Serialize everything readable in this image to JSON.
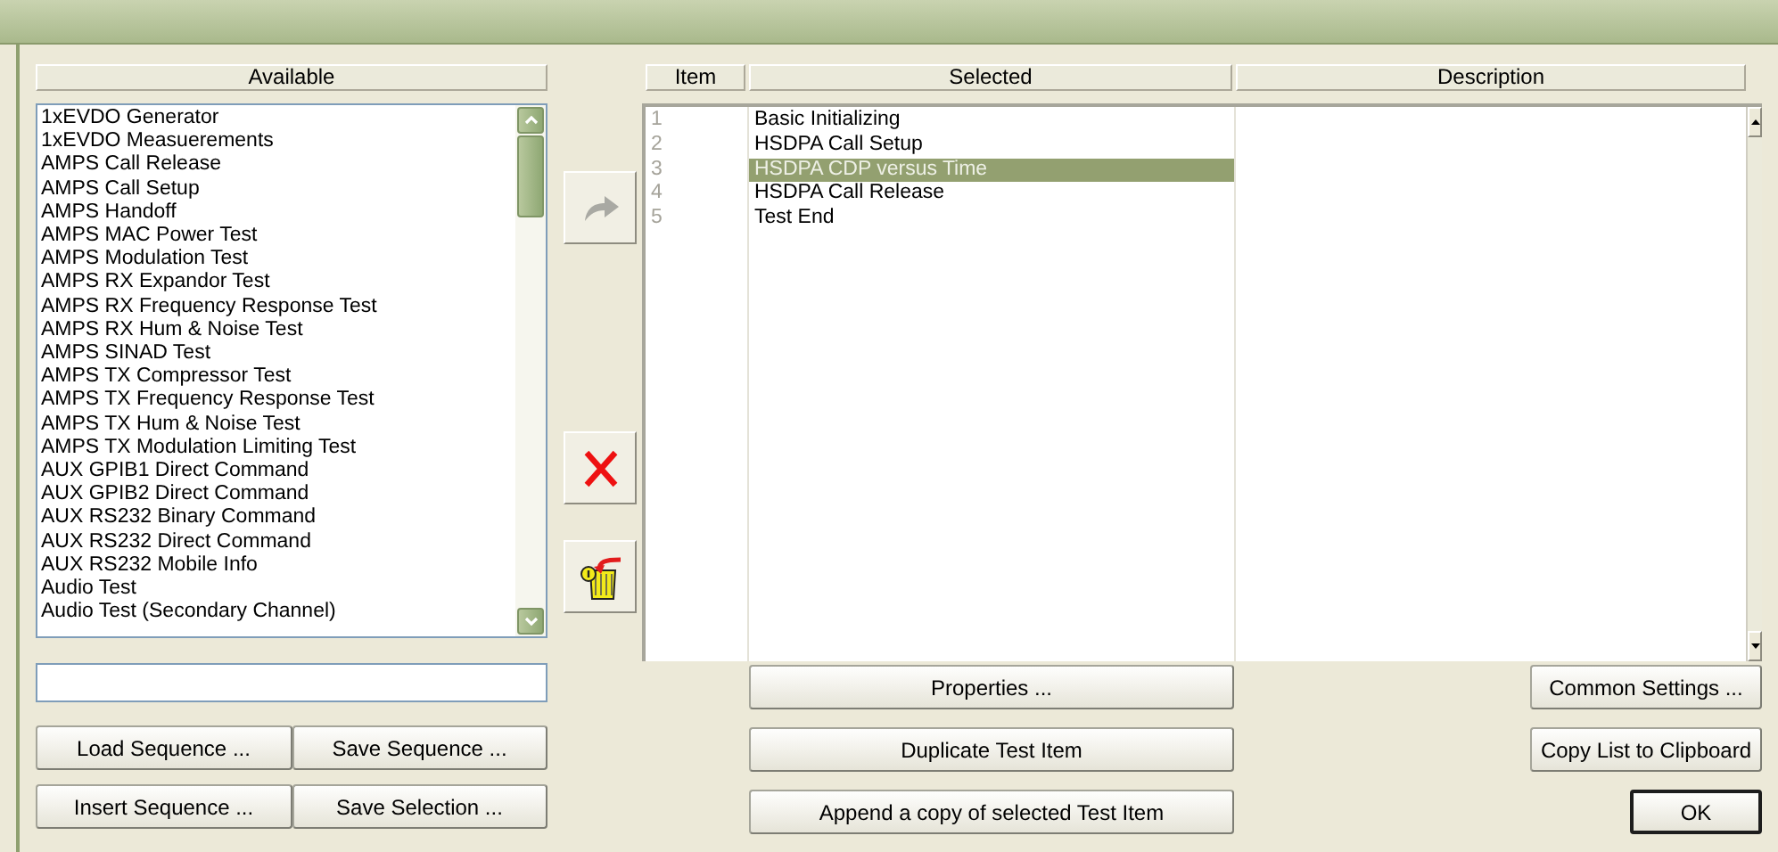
{
  "available": {
    "header": "Available",
    "items": [
      "1xEVDO Generator",
      "1xEVDO Measuerements",
      "AMPS Call Release",
      "AMPS Call Setup",
      "AMPS Handoff",
      "AMPS MAC Power Test",
      "AMPS Modulation Test",
      "AMPS RX Expandor Test",
      "AMPS RX Frequency Response Test",
      "AMPS RX Hum & Noise Test",
      "AMPS SINAD Test",
      "AMPS TX Compressor Test",
      "AMPS TX Frequency Response Test",
      "AMPS TX Hum & Noise Test",
      "AMPS TX Modulation Limiting Test",
      "AUX GPIB1 Direct Command",
      "AUX GPIB2 Direct Command",
      "AUX RS232 Binary Command",
      "AUX RS232 Direct Command",
      "AUX RS232 Mobile Info",
      "Audio Test",
      "Audio Test (Secondary Channel)"
    ],
    "buttons": [
      "Load Sequence ...",
      "Save Sequence ...",
      "Insert Sequence ...",
      "Save Selection ..."
    ]
  },
  "side_buttons": [
    {
      "kind": "add",
      "disabled": true
    },
    {
      "kind": "remove",
      "disabled": false
    },
    {
      "kind": "clear",
      "disabled": false
    }
  ],
  "sequence": {
    "columns": [
      "Item",
      "Selected",
      "Description"
    ],
    "rows": [
      {
        "item": "1",
        "name": "Basic Initializing",
        "selected": false
      },
      {
        "item": "2",
        "name": "HSDPA Call Setup",
        "selected": false
      },
      {
        "item": "3",
        "name": "HSDPA CDP versus Time",
        "selected": true
      },
      {
        "item": "4",
        "name": "HSDPA Call Release",
        "selected": false
      },
      {
        "item": "5",
        "name": "Test End",
        "selected": false
      }
    ],
    "buttons": [
      "Properties ...",
      "Duplicate Test Item",
      "Append a copy of selected Test Item"
    ]
  },
  "right_buttons": [
    {
      "label": "Common Settings ...",
      "default": false
    },
    {
      "label": "Copy List to Clipboard",
      "default": false
    },
    {
      "label": "OK",
      "default": true
    }
  ]
}
